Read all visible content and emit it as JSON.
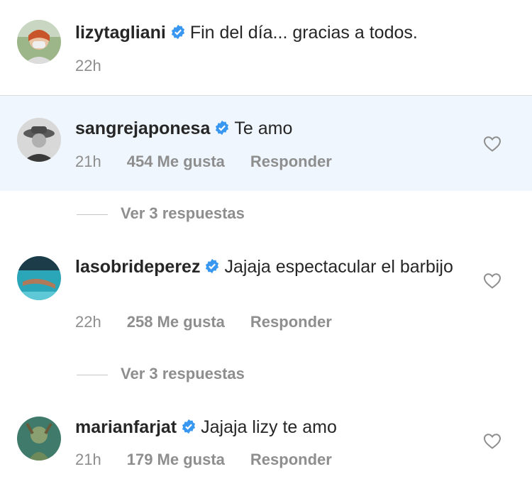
{
  "caption": {
    "username": "lizytagliani",
    "text": "Fin del día... gracias a todos.",
    "time": "22h"
  },
  "comments": [
    {
      "username": "sangrejaponesa",
      "text": "Te amo",
      "time": "21h",
      "likes": "454 Me gusta",
      "reply_label": "Responder",
      "view_replies": "Ver 3 respuestas"
    },
    {
      "username": "lasobrideperez",
      "text": "Jajaja espectacular el barbijo",
      "time": "22h",
      "likes": "258 Me gusta",
      "reply_label": "Responder",
      "view_replies": "Ver 3 respuestas"
    },
    {
      "username": "marianfarjat",
      "text": "Jajaja lizy te amo",
      "time": "21h",
      "likes": "179 Me gusta",
      "reply_label": "Responder"
    }
  ],
  "icons": {
    "verified": "verified-badge-icon",
    "heart": "heart-outline-icon"
  },
  "colors": {
    "verified": "#3897f0",
    "highlight": "#eff6fd",
    "secondary_text": "#8e8e8e"
  }
}
